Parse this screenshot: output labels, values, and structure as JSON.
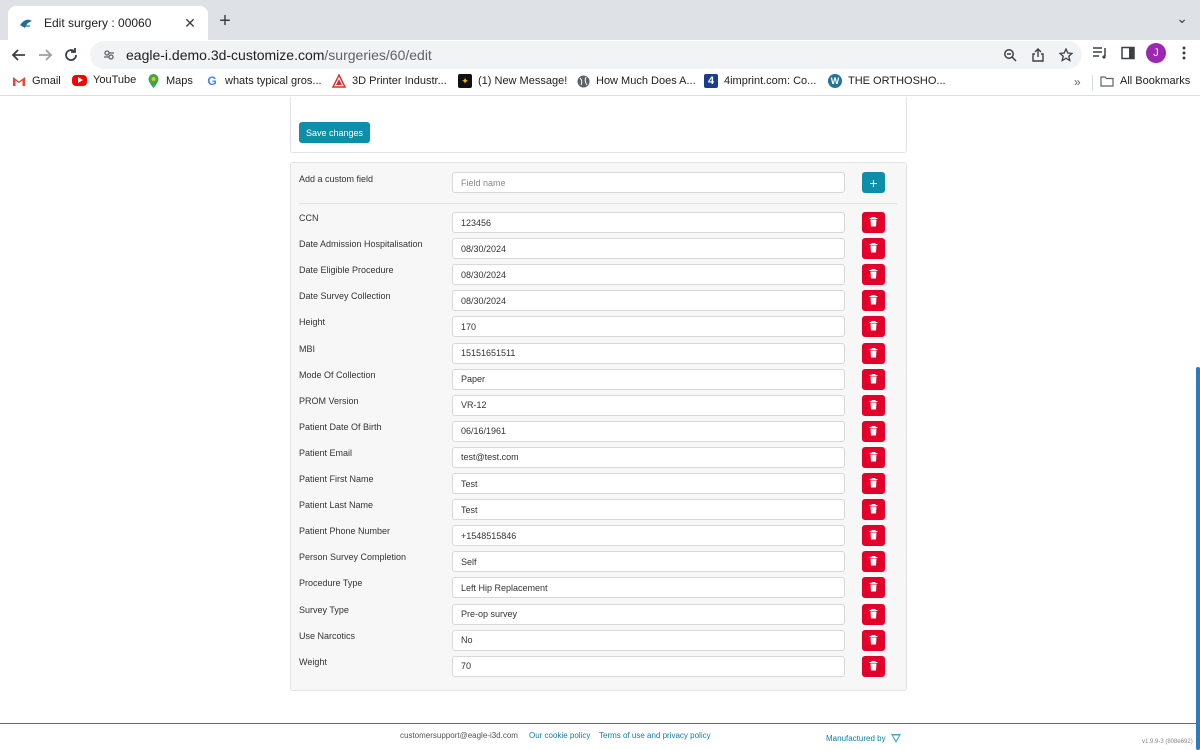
{
  "browser": {
    "tab_title": "Edit surgery : 00060",
    "url_host": "eagle-i.demo.3d-customize.com",
    "url_path": "/surgeries/60/edit",
    "avatar_letter": "J"
  },
  "bookmarks": [
    {
      "label": "Gmail",
      "icon": "gmail-icon"
    },
    {
      "label": "YouTube",
      "icon": "youtube-icon"
    },
    {
      "label": "Maps",
      "icon": "maps-icon"
    },
    {
      "label": "whats typical gros...",
      "icon": "google-icon"
    },
    {
      "label": "3D Printer Industr...",
      "icon": "printer-icon"
    },
    {
      "label": "(1) New Message!",
      "icon": "message-icon"
    },
    {
      "label": "How Much Does A...",
      "icon": "globe-icon"
    },
    {
      "label": "4imprint.com: Co...",
      "icon": "4imprint-icon"
    },
    {
      "label": "THE ORTHOSHO...",
      "icon": "wordpress-icon"
    }
  ],
  "all_bookmarks_label": "All Bookmarks",
  "form": {
    "save_label": "Save changes",
    "add_field_label": "Add a custom field",
    "add_field_placeholder": "Field name",
    "fields": [
      {
        "label": "CCN",
        "value": "123456"
      },
      {
        "label": "Date Admission Hospitalisation",
        "value": "08/30/2024"
      },
      {
        "label": "Date Eligible Procedure",
        "value": "08/30/2024"
      },
      {
        "label": "Date Survey Collection",
        "value": "08/30/2024"
      },
      {
        "label": "Height",
        "value": "170"
      },
      {
        "label": "MBI",
        "value": "15151651511"
      },
      {
        "label": "Mode Of Collection",
        "value": "Paper"
      },
      {
        "label": "PROM Version",
        "value": "VR-12"
      },
      {
        "label": "Patient Date Of Birth",
        "value": "06/16/1961"
      },
      {
        "label": "Patient Email",
        "value": "test@test.com"
      },
      {
        "label": "Patient First Name",
        "value": "Test"
      },
      {
        "label": "Patient Last Name",
        "value": "Test"
      },
      {
        "label": "Patient Phone Number",
        "value": "+1548515846"
      },
      {
        "label": "Person Survey Completion",
        "value": "Self"
      },
      {
        "label": "Procedure Type",
        "value": "Left Hip Replacement"
      },
      {
        "label": "Survey Type",
        "value": "Pre-op survey"
      },
      {
        "label": "Use Narcotics",
        "value": "No"
      },
      {
        "label": "Weight",
        "value": "70"
      }
    ]
  },
  "footer": {
    "email": "customersupport@eagle-i3d.com",
    "cookie_policy": "Our cookie policy",
    "terms": "Terms of use and privacy policy",
    "manufactured_by": "Manufactured by",
    "version": "v1.9.9-3 (808e692)"
  },
  "colors": {
    "accent": "#0f8ea8",
    "danger": "#e3002b"
  }
}
